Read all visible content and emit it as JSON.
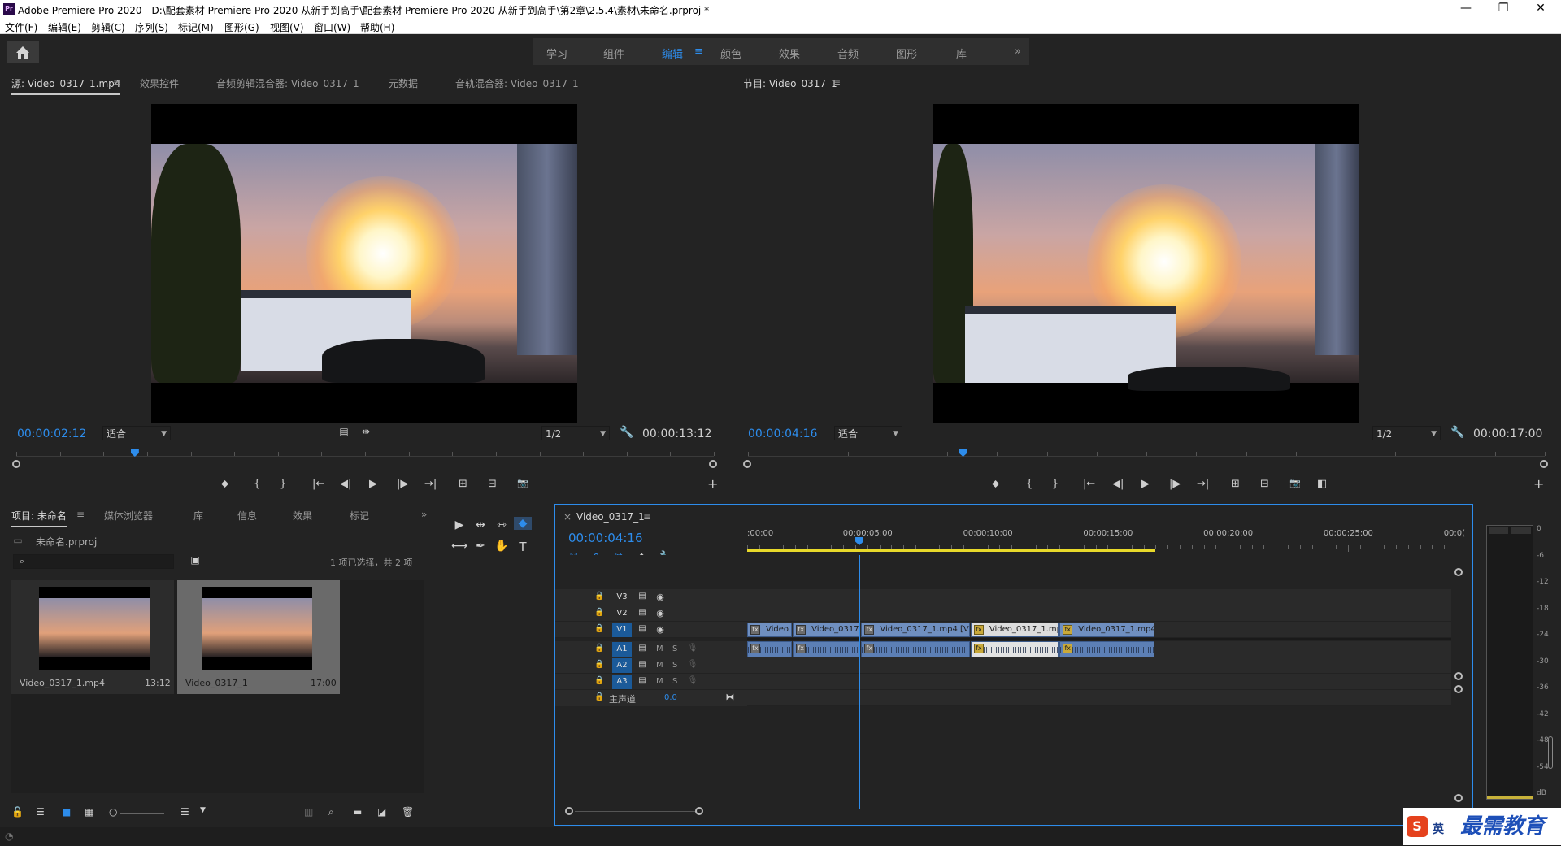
{
  "window": {
    "title": "Adobe Premiere Pro 2020 - D:\\配套素材 Premiere Pro 2020 从新手到高手\\配套素材 Premiere Pro 2020 从新手到高手\\第2章\\2.5.4\\素材\\未命名.prproj *",
    "logo": "Pr",
    "minimize": "—",
    "maximize": "❐",
    "close": "✕"
  },
  "menu": [
    "文件(F)",
    "编辑(E)",
    "剪辑(C)",
    "序列(S)",
    "标记(M)",
    "图形(G)",
    "视图(V)",
    "窗口(W)",
    "帮助(H)"
  ],
  "workspaces": {
    "tabs": [
      "学习",
      "组件",
      "编辑",
      "颜色",
      "效果",
      "音频",
      "图形",
      "库"
    ],
    "active": "编辑",
    "more": "»",
    "menu_glyph": "≡"
  },
  "source": {
    "tabs": [
      "源: Video_0317_1.mp4",
      "效果控件",
      "音频剪辑混合器: Video_0317_1",
      "元数据",
      "音轨混合器: Video_0317_1"
    ],
    "menu_glyph": "≡",
    "timecode": "00:00:02:12",
    "fit": "适合",
    "resolution": "1/2",
    "duration": "00:00:13:12",
    "playhead_fraction": 0.17
  },
  "program": {
    "tab": "节目: Video_0317_1",
    "menu_glyph": "≡",
    "timecode": "00:00:04:16",
    "fit": "适合",
    "resolution": "1/2",
    "duration": "00:00:17:00",
    "playhead_fraction": 0.27
  },
  "transport": {
    "marker": "⬥",
    "in": "{",
    "out": "}",
    "goto_in": "|←",
    "step_back": "◀|",
    "play": "▶",
    "step_fwd": "|▶",
    "goto_out": "→|",
    "insert": "⊞",
    "overwrite": "⊟",
    "export_frame": "📷",
    "add": "+"
  },
  "project": {
    "tabs": [
      "项目: 未命名",
      "媒体浏览器",
      "库",
      "信息",
      "效果",
      "标记"
    ],
    "more": "»",
    "menu_glyph": "≡",
    "file": "未命名.prproj",
    "search_placeholder": "",
    "selection": "1 项已选择，共 2 项",
    "items": [
      {
        "name": "Video_0317_1.mp4",
        "duration": "13:12",
        "selected": false
      },
      {
        "name": "Video_0317_1",
        "duration": "17:00",
        "selected": true
      }
    ]
  },
  "tools": [
    "▶",
    "⇹",
    "⇿",
    "◆",
    "⟷",
    "✒",
    "✋",
    "T"
  ],
  "timeline": {
    "close": "×",
    "sequence_tab": "Video_0317_1",
    "menu_glyph": "≡",
    "timecode": "00:00:04:16",
    "ruler_labels": [
      ":00:00",
      "00:00:05:00",
      "00:00:10:00",
      "00:00:15:00",
      "00:00:20:00",
      "00:00:25:00",
      "00:0("
    ],
    "video_tracks": [
      "V3",
      "V2",
      "V1"
    ],
    "audio_tracks": [
      "A1",
      "A2",
      "A3"
    ],
    "master_label": "主声道",
    "master_value": "0.0",
    "mute": "M",
    "solo": "S",
    "fx_glyph": "fx",
    "video_clips": [
      {
        "label": "Video",
        "fx": "gray",
        "start": 0.0,
        "end": 1.9
      },
      {
        "label": "Video_0317",
        "fx": "gray",
        "start": 1.9,
        "end": 4.75
      },
      {
        "label": "Video_0317_1.mp4 [V]",
        "fx": "gray",
        "start": 4.75,
        "end": 9.3
      },
      {
        "label": "Video_0317_1.mp",
        "fx": "yellow",
        "start": 9.3,
        "end": 13.0,
        "selected": true
      },
      {
        "label": "Video_0317_1.mp4 [",
        "fx": "yellow",
        "start": 13.0,
        "end": 17.0
      }
    ],
    "audio_clips": [
      {
        "fx": "gray",
        "start": 0.0,
        "end": 1.9
      },
      {
        "fx": "gray",
        "start": 1.9,
        "end": 4.75
      },
      {
        "fx": "gray",
        "start": 4.75,
        "end": 9.3
      },
      {
        "fx": "yellow",
        "start": 9.3,
        "end": 13.0,
        "selected": true
      },
      {
        "fx": "yellow",
        "start": 13.0,
        "end": 17.0
      }
    ],
    "work_area_end_sec": 17.0,
    "playhead_sec": 4.67,
    "view_span_sec": 29.3
  },
  "meter": {
    "scale": [
      "0",
      "-6",
      "-12",
      "-18",
      "-24",
      "-30",
      "-36",
      "-42",
      "-48",
      "-54",
      "dB"
    ]
  },
  "watermark": {
    "text": "最需教育",
    "ime": "英"
  },
  "colors": {
    "accent": "#2d8ceb",
    "panel": "#232323",
    "clip_video": "#6f8fc0",
    "clip_audio": "#5c7fb5",
    "work_area": "#e8d92a"
  }
}
